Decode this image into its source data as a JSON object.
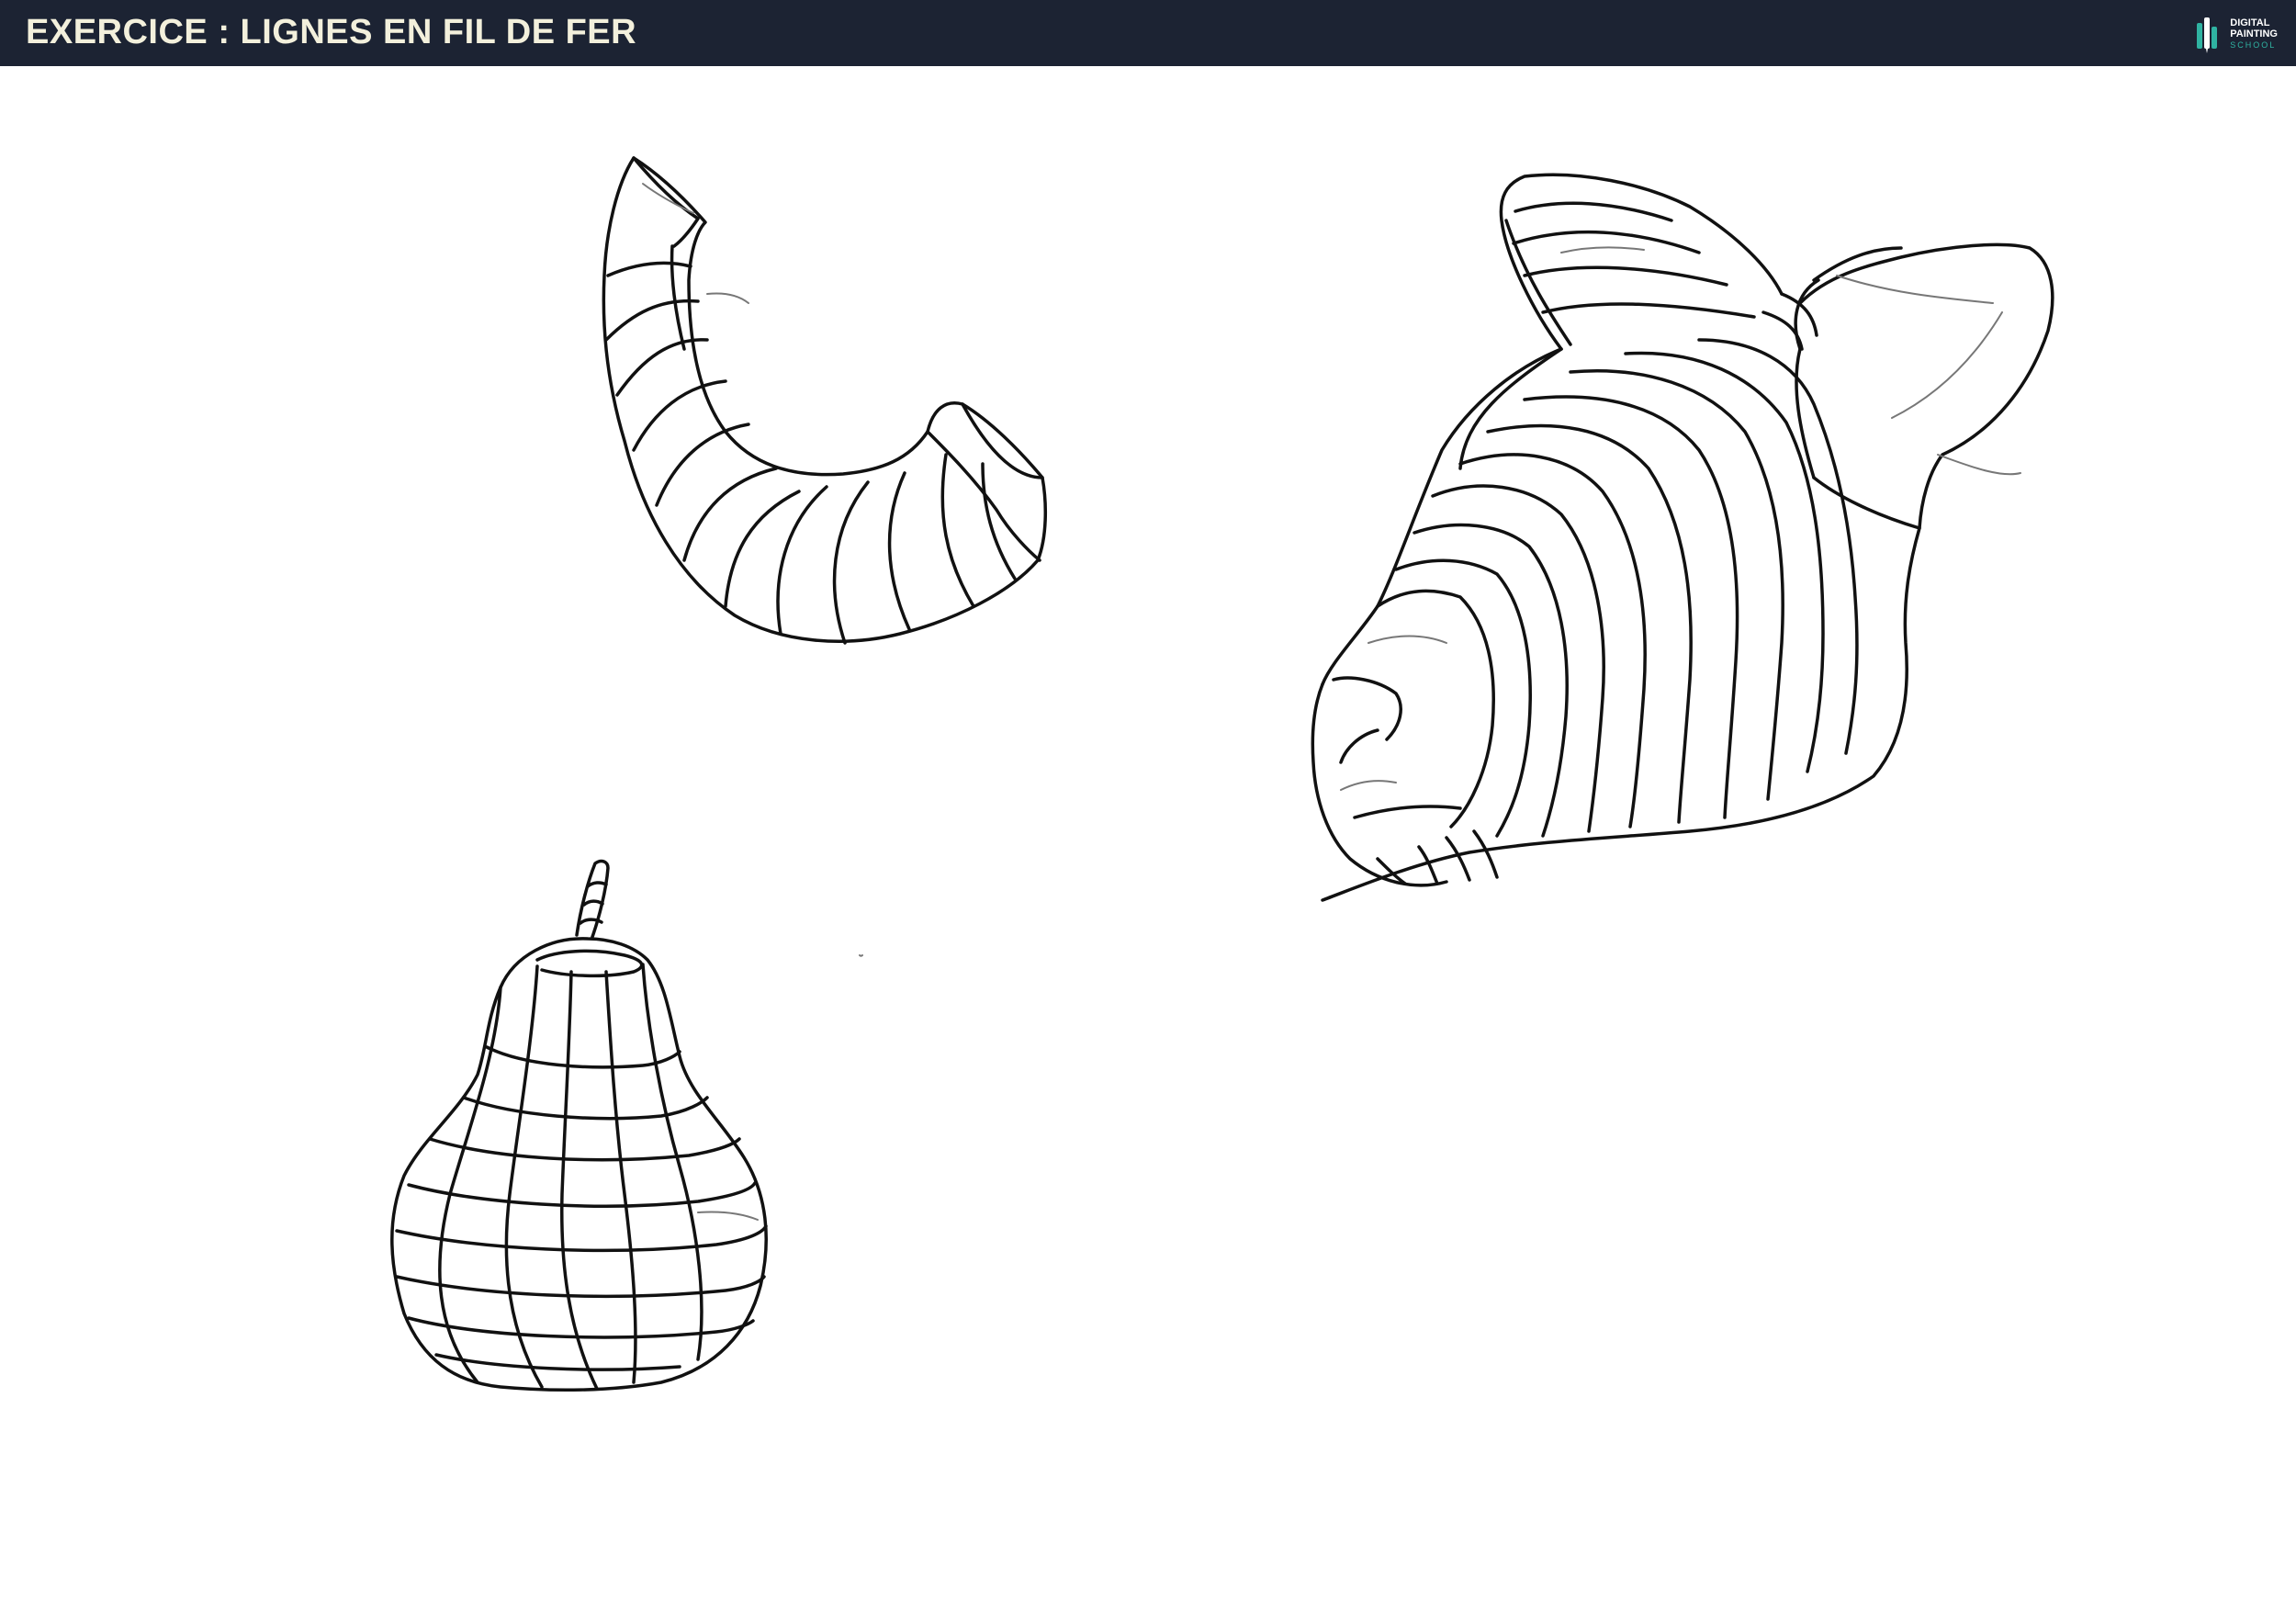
{
  "header": {
    "title": "EXERCICE : LIGNES EN FIL DE FER",
    "background": "#1c2333",
    "title_color": "#f3f0dc"
  },
  "brand": {
    "line1": "DIGITAL",
    "line2": "PAINTING",
    "line3": "SCHOOL",
    "logo_icon": "brush-logo-icon",
    "accent": "#2fb3a2"
  },
  "canvas": {
    "background": "#ffffff",
    "stroke_color": "#111111"
  }
}
